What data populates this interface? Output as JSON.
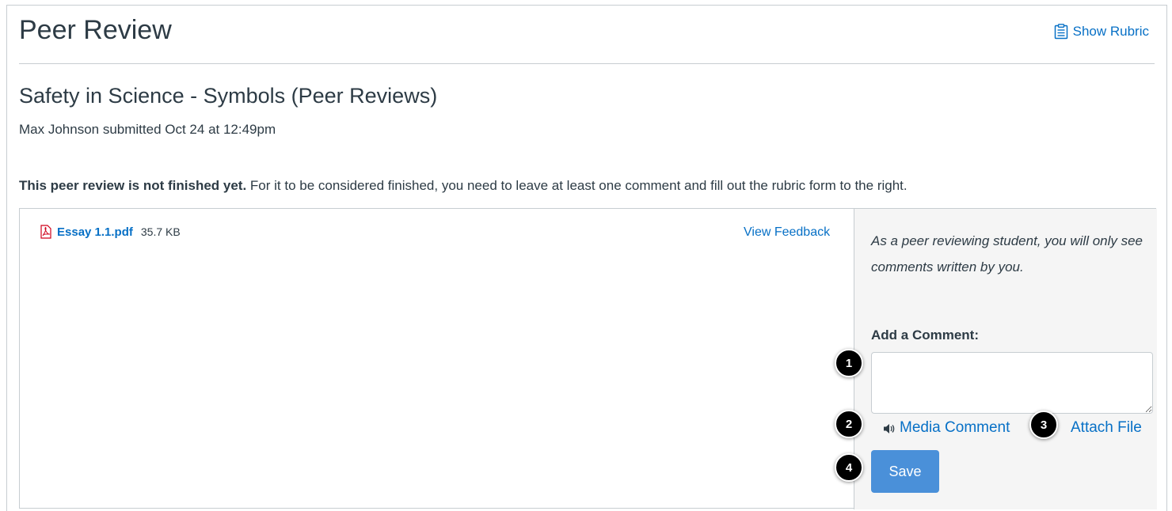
{
  "header": {
    "title": "Peer Review",
    "show_rubric_label": "Show Rubric"
  },
  "assignment": {
    "title": "Safety in Science - Symbols (Peer Reviews)",
    "submitted_line": "Max Johnson submitted Oct 24 at 12:49pm"
  },
  "notice": {
    "bold": "This peer review is not finished yet.",
    "rest": " For it to be considered finished, you need to leave at least one comment and fill out the rubric form to the right."
  },
  "submission": {
    "file_name": "Essay 1.1.pdf",
    "file_size": "35.7 KB",
    "view_feedback_label": "View Feedback"
  },
  "comment_panel": {
    "note": "As a peer reviewing student, you will only see comments written by you.",
    "add_comment_label": "Add a Comment:",
    "comment_value": "",
    "media_comment_label": "Media Comment",
    "attach_file_label": "Attach File",
    "save_label": "Save"
  },
  "callouts": [
    "1",
    "2",
    "3",
    "4"
  ],
  "icons": {
    "rubric": "clipboard-icon",
    "file": "pdf-icon",
    "media": "speaker-icon"
  },
  "colors": {
    "link": "#0770c6",
    "primary_button": "#4a90d9",
    "text": "#2d3b45",
    "border": "#c7cdd1",
    "panel_bg": "#f5f5f5"
  }
}
